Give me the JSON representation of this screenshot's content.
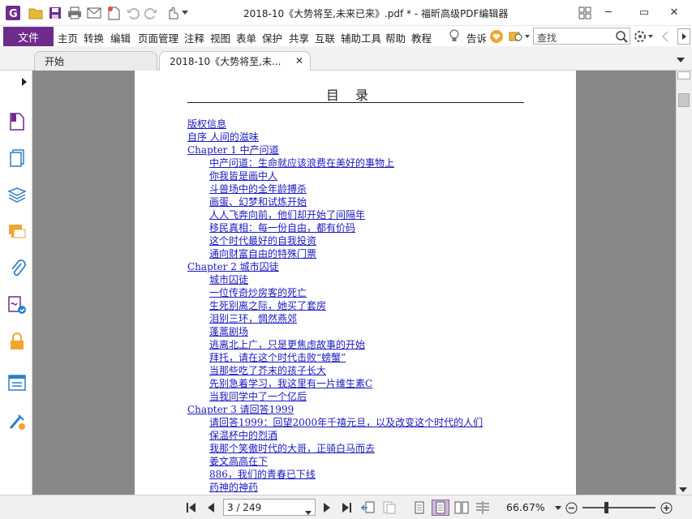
{
  "window": {
    "title": "2018-10《大势将至,未来已来》.pdf * - 福昕高级PDF编辑器",
    "minimize": "─",
    "restore": "▭",
    "close": "✕"
  },
  "menu": {
    "file": "文件",
    "items": [
      "主页",
      "转换",
      "编辑",
      "页面管理",
      "注释",
      "视图",
      "表单",
      "保护",
      "共享",
      "互联",
      "辅助工具",
      "帮助",
      "教程"
    ],
    "tell": "告诉",
    "search_placeholder": "查找"
  },
  "tabs": [
    {
      "label": "开始"
    },
    {
      "label": "2018-10《大势将至,未...",
      "close": "✕"
    }
  ],
  "document": {
    "toc_title": "目录",
    "entries": [
      {
        "text": "版权信息",
        "level": 1
      },
      {
        "text": "自序 人间的滋味",
        "level": 1
      },
      {
        "text": "Chapter 1 中产问道",
        "level": 1
      },
      {
        "text": "中产问道：生命就应该浪费在美好的事物上",
        "level": 2
      },
      {
        "text": "你我皆是画中人",
        "level": 2
      },
      {
        "text": "斗兽场中的全年龄搏杀",
        "level": 2
      },
      {
        "text": "画蛋、幻梦和试炼开始",
        "level": 2
      },
      {
        "text": "人人飞奔向前，他们却开始了间隔年",
        "level": 2
      },
      {
        "text": "移民真相：每一份自由，都有价码",
        "level": 2
      },
      {
        "text": "这个时代最好的自我投资",
        "level": 2
      },
      {
        "text": "通向财富自由的特殊门票",
        "level": 2
      },
      {
        "text": "Chapter 2 城市囚徒",
        "level": 1
      },
      {
        "text": "城市囚徒",
        "level": 2
      },
      {
        "text": "一位传奇炒房客的死亡",
        "level": 2
      },
      {
        "text": "生死别离之际，她买了套房",
        "level": 2
      },
      {
        "text": "泪别三环，惆然燕郊",
        "level": 2
      },
      {
        "text": "蓬蒿剧场",
        "level": 2
      },
      {
        "text": "逃离北上广，只是更焦虑故事的开始",
        "level": 2
      },
      {
        "text": "拜托，请在这个时代击败“螃蟹”",
        "level": 2
      },
      {
        "text": "当那些吃了芥末的孩子长大",
        "level": 2
      },
      {
        "text": "先别急着学习，我这里有一片维生素C",
        "level": 2
      },
      {
        "text": "当我同学中了一个亿后",
        "level": 2
      },
      {
        "text": "Chapter 3 请回答1999",
        "level": 1
      },
      {
        "text": "请回答1999：回望2000年千禧元旦，以及改变这个时代的人们",
        "level": 2
      },
      {
        "text": "保温杯中的烈酒",
        "level": 2
      },
      {
        "text": "我那个笑傲时代的大哥，正骑白马而去",
        "level": 2
      },
      {
        "text": "姜文高高在下",
        "level": 2
      },
      {
        "text": "886，我们的青春已下线",
        "level": 2
      },
      {
        "text": "药神的神药",
        "level": 2
      }
    ]
  },
  "status": {
    "page_indicator": "3 / 249",
    "zoom": "66.67%"
  },
  "colors": {
    "accent": "#6d2c8c",
    "link": "#1a1ac0",
    "doc_background": "#888888"
  }
}
